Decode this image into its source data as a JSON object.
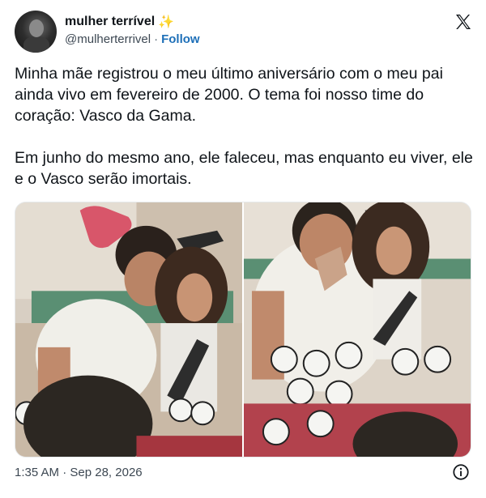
{
  "author": {
    "name": "mulher terrível",
    "emoji": "✨",
    "handle": "@mulherterrivel",
    "separator": "·",
    "follow_label": "Follow"
  },
  "tweet": {
    "paragraph_1": "Minha mãe registrou o meu último aniversário com o meu pai ainda vivo em fevereiro de 2000. O tema foi nosso time do coração: Vasco da Gama.",
    "paragraph_2": "Em junho do mesmo ano, ele faleceu, mas enquanto eu viver, ele e o Vasco serão imortais."
  },
  "footer": {
    "time": "1:35 AM",
    "separator": "·",
    "date": "Sep 28, 2026"
  },
  "icons": {
    "platform_logo": "x-logo-icon",
    "info": "info-icon",
    "verified_sparkle": "sparkles-icon"
  },
  "colors": {
    "text": "#0f1419",
    "secondary": "#536471",
    "follow": "#1d6fb8"
  }
}
